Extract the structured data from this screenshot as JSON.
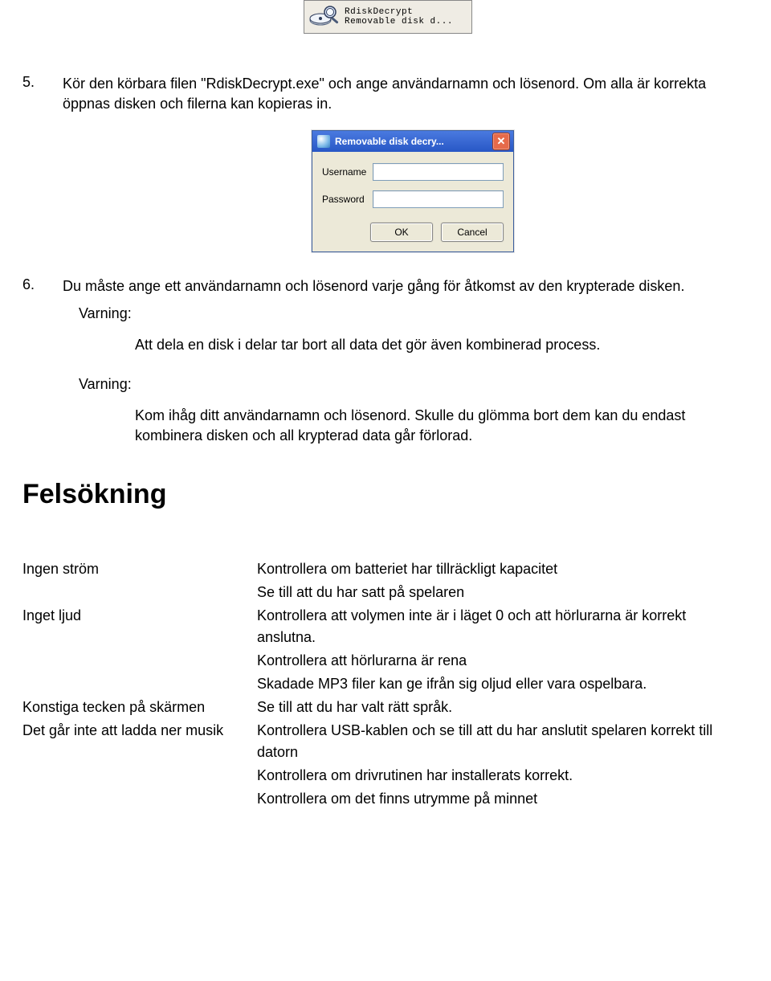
{
  "taskbar": {
    "title": "RdiskDecrypt",
    "subtitle": "Removable disk d..."
  },
  "steps": {
    "s5": {
      "num": "5.",
      "text": "Kör den körbara filen \"RdiskDecrypt.exe\" och ange användarnamn och lösenord. Om alla är korrekta öppnas disken och filerna kan kopieras in."
    },
    "s6": {
      "num": "6.",
      "text": "Du måste ange ett användarnamn och lösenord varje gång för åtkomst av den krypterade disken."
    }
  },
  "dialog": {
    "title": "Removable disk decry...",
    "username_label": "Username",
    "password_label": "Password",
    "ok": "OK",
    "cancel": "Cancel"
  },
  "warnings": {
    "label": "Varning:",
    "w1": "Att dela en disk i delar tar bort all data det gör även kombinerad process.",
    "w2": "Kom ihåg ditt användarnamn och lösenord. Skulle du glömma bort dem kan du endast kombinera disken och all krypterad data går förlorad."
  },
  "troubleshoot": {
    "title": "Felsökning",
    "rows": [
      {
        "issue": "Ingen ström",
        "fix": "Kontrollera om batteriet har tillräckligt kapacitet"
      },
      {
        "issue": "",
        "fix": "Se till att du har satt på spelaren"
      },
      {
        "issue": "Inget ljud",
        "fix": "Kontrollera att volymen inte är i läget 0 och att hörlurarna är korrekt anslutna."
      },
      {
        "issue": "",
        "fix": "Kontrollera att hörlurarna är rena"
      },
      {
        "issue": "",
        "fix": "Skadade MP3 filer kan ge ifrån sig oljud eller vara ospelbara."
      },
      {
        "issue": "Konstiga tecken på skärmen",
        "fix": "Se till att du har valt rätt språk."
      },
      {
        "issue": "Det går inte att ladda ner musik",
        "fix": "Kontrollera USB-kablen och se till att du har anslutit spelaren korrekt till datorn"
      },
      {
        "issue": "",
        "fix": "Kontrollera om drivrutinen har installerats korrekt."
      },
      {
        "issue": "",
        "fix": "Kontrollera om det finns utrymme på minnet"
      }
    ]
  }
}
